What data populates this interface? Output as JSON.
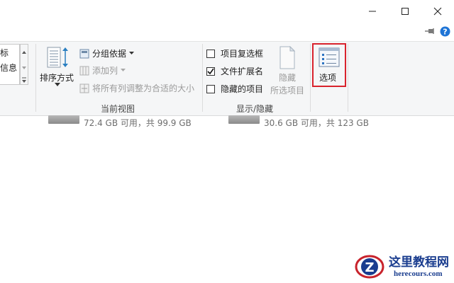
{
  "window_controls": {
    "minimize_label": "Minimize",
    "maximize_label": "Maximize",
    "close_label": "Close"
  },
  "ribbon_top": {
    "pin_icon": "pin-icon",
    "help_icon": "help-icon"
  },
  "layout_partial": {
    "line1": "标",
    "line2": "信息"
  },
  "current_view": {
    "sort_label": "排序方式",
    "group_by_label": "分组依据",
    "add_column_label": "添加列",
    "fit_columns_label": "将所有列调整为合适的大小",
    "group_label": "当前视图"
  },
  "show_hide": {
    "item_checkbox_label": "项目复选框",
    "item_checkbox_checked": false,
    "file_ext_label": "文件扩展名",
    "file_ext_checked": true,
    "hidden_items_label": "隐藏的项目",
    "hidden_items_checked": false,
    "hide_selected_line1": "隐藏",
    "hide_selected_line2": "所选项目",
    "group_label": "显示/隐藏"
  },
  "options": {
    "label": "选项"
  },
  "drives": [
    {
      "text": "72.4 GB 可用，共 99.9 GB"
    },
    {
      "text": "30.6 GB 可用，共 123 GB"
    }
  ],
  "watermark": {
    "cn": "这里教程网",
    "en": "herecours.com",
    "logo_letter": "Z"
  }
}
